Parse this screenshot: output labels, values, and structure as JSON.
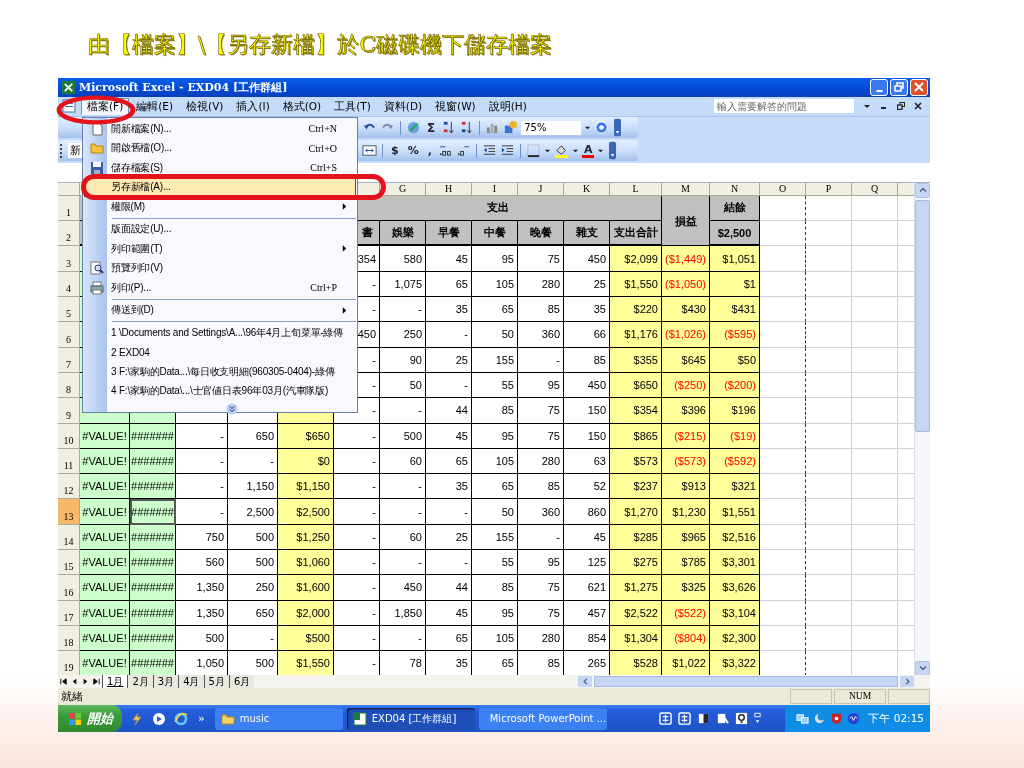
{
  "slide_title": "由【檔案】\\【另存新檔】於C磁碟機下儲存檔案",
  "window": {
    "title": "Microsoft Excel - EXD04  [工作群組]"
  },
  "menu_bar": [
    {
      "label": "檔案(F)",
      "selected": true
    },
    {
      "label": "編輯(E)",
      "selected": false
    },
    {
      "label": "檢視(V)",
      "selected": false
    },
    {
      "label": "插入(I)",
      "selected": false
    },
    {
      "label": "格式(O)",
      "selected": false
    },
    {
      "label": "工具(T)",
      "selected": false
    },
    {
      "label": "資料(D)",
      "selected": false
    },
    {
      "label": "視窗(W)",
      "selected": false
    },
    {
      "label": "說明(H)",
      "selected": false
    }
  ],
  "help_box": {
    "placeholder": "輸入需要解答的問題"
  },
  "standard_toolbar": {
    "sum": "Σ",
    "zoom": "75%"
  },
  "formatting_toolbar": {
    "font": "新",
    "buttons": [
      "$",
      "%",
      ","
    ],
    "font_color": "A"
  },
  "column_headers": [
    "G",
    "H",
    "I",
    "J",
    "K",
    "L",
    "M",
    "N",
    "O",
    "P",
    "Q"
  ],
  "rows": [
    {
      "header": "1",
      "kind": "group-heading",
      "selected": false,
      "cells": [
        null,
        null,
        null,
        null,
        null,
        "支出",
        null,
        null,
        null,
        null,
        null,
        null,
        "損益",
        "結餘"
      ]
    },
    {
      "header": "2",
      "kind": "column-heading",
      "selected": false,
      "cells": [
        null,
        null,
        null,
        null,
        null,
        "書",
        "娛樂",
        "早餐",
        "中餐",
        "晚餐",
        "雜支",
        "支出合計",
        null,
        "$2,500"
      ]
    },
    {
      "header": "3",
      "kind": "data",
      "selected": false,
      "cells": [
        null,
        null,
        null,
        null,
        null,
        "354",
        "580",
        "45",
        "95",
        "75",
        "450",
        "$2,099",
        {
          "text": "($1,449)",
          "negative": true
        },
        "$1,051"
      ]
    },
    {
      "header": "4",
      "kind": "data",
      "selected": false,
      "cells": [
        null,
        null,
        null,
        null,
        null,
        "-",
        "1,075",
        "65",
        "105",
        "280",
        "25",
        "$1,550",
        {
          "text": "($1,050)",
          "negative": true
        },
        "$1"
      ]
    },
    {
      "header": "5",
      "kind": "data",
      "selected": false,
      "cells": [
        null,
        null,
        null,
        null,
        null,
        "-",
        "-",
        "35",
        "65",
        "85",
        "35",
        "$220",
        "$430",
        "$431"
      ]
    },
    {
      "header": "6",
      "kind": "data",
      "selected": false,
      "cells": [
        null,
        null,
        null,
        null,
        null,
        "450",
        "250",
        "-",
        "50",
        "360",
        "66",
        "$1,176",
        {
          "text": "($1,026)",
          "negative": true
        },
        {
          "text": "($595)",
          "negative": true
        }
      ]
    },
    {
      "header": "7",
      "kind": "data",
      "selected": false,
      "cells": [
        null,
        null,
        null,
        null,
        null,
        "-",
        "90",
        "25",
        "155",
        "-",
        "85",
        "$355",
        "$645",
        "$50"
      ]
    },
    {
      "header": "8",
      "kind": "data",
      "selected": false,
      "cells": [
        null,
        null,
        null,
        null,
        null,
        "-",
        "50",
        "-",
        "55",
        "95",
        "450",
        "$650",
        {
          "text": "($250)",
          "negative": true
        },
        {
          "text": "($200)",
          "negative": true
        }
      ]
    },
    {
      "header": "9",
      "kind": "data",
      "selected": false,
      "cells": [
        null,
        null,
        null,
        null,
        null,
        "-",
        "-",
        "44",
        "85",
        "75",
        "150",
        "$354",
        "$396",
        "$196"
      ]
    },
    {
      "header": "10",
      "kind": "data",
      "selected": false,
      "cells": [
        "#VALUE!",
        "#######",
        "-",
        "650",
        "$650",
        "-",
        "500",
        "45",
        "95",
        "75",
        "150",
        "$865",
        {
          "text": "($215)",
          "negative": true
        },
        {
          "text": "($19)",
          "negative": true
        }
      ]
    },
    {
      "header": "11",
      "kind": "data",
      "selected": false,
      "cells": [
        "#VALUE!",
        "#######",
        "-",
        "-",
        "$0",
        "-",
        "60",
        "65",
        "105",
        "280",
        "63",
        "$573",
        {
          "text": "($573)",
          "negative": true
        },
        {
          "text": "($592)",
          "negative": true
        }
      ]
    },
    {
      "header": "12",
      "kind": "data",
      "selected": false,
      "cells": [
        "#VALUE!",
        "#######",
        "-",
        "1,150",
        "$1,150",
        "-",
        "-",
        "35",
        "65",
        "85",
        "52",
        "$237",
        "$913",
        "$321"
      ]
    },
    {
      "header": "13",
      "kind": "data",
      "selected": true,
      "cells": [
        "#VALUE!",
        {
          "text": "#######",
          "active": true
        },
        "-",
        "2,500",
        "$2,500",
        "-",
        "-",
        "-",
        "50",
        "360",
        "860",
        "$1,270",
        "$1,230",
        "$1,551"
      ]
    },
    {
      "header": "14",
      "kind": "data",
      "selected": false,
      "cells": [
        "#VALUE!",
        "#######",
        "750",
        "500",
        "$1,250",
        "-",
        "60",
        "25",
        "155",
        "-",
        "45",
        "$285",
        "$965",
        "$2,516"
      ]
    },
    {
      "header": "15",
      "kind": "data",
      "selected": false,
      "cells": [
        "#VALUE!",
        "#######",
        "560",
        "500",
        "$1,060",
        "-",
        "-",
        "-",
        "55",
        "95",
        "125",
        "$275",
        "$785",
        "$3,301"
      ]
    },
    {
      "header": "16",
      "kind": "data",
      "selected": false,
      "cells": [
        "#VALUE!",
        "#######",
        "1,350",
        "250",
        "$1,600",
        "-",
        "450",
        "44",
        "85",
        "75",
        "621",
        "$1,275",
        "$325",
        "$3,626"
      ]
    },
    {
      "header": "17",
      "kind": "data",
      "selected": false,
      "cells": [
        "#VALUE!",
        "#######",
        "1,350",
        "650",
        "$2,000",
        "-",
        "1,850",
        "45",
        "95",
        "75",
        "457",
        "$2,522",
        {
          "text": "($522)",
          "negative": true
        },
        "$3,104"
      ]
    },
    {
      "header": "18",
      "kind": "data",
      "selected": false,
      "cells": [
        "#VALUE!",
        "#######",
        "500",
        "-",
        "$500",
        "-",
        "-",
        "65",
        "105",
        "280",
        "854",
        "$1,304",
        {
          "text": "($804)",
          "negative": true
        },
        "$2,300"
      ]
    },
    {
      "header": "19",
      "kind": "data",
      "selected": false,
      "cells": [
        "#VALUE!",
        "#######",
        "1,050",
        "500",
        "$1,550",
        "-",
        "78",
        "35",
        "65",
        "85",
        "265",
        "$528",
        "$1,022",
        "$3,322"
      ]
    }
  ],
  "file_menu": [
    {
      "kind": "item",
      "label": "開新檔案(N)...",
      "shortcut": "Ctrl+N",
      "submenu": false,
      "selected": false
    },
    {
      "kind": "item",
      "label": "開啟舊檔(O)...",
      "shortcut": "Ctrl+O",
      "submenu": false,
      "selected": false
    },
    {
      "kind": "item",
      "label": "儲存檔案(S)",
      "shortcut": "Ctrl+S",
      "submenu": false,
      "selected": false
    },
    {
      "kind": "item",
      "label": "另存新檔(A)...",
      "submenu": false,
      "selected": true
    },
    {
      "kind": "item",
      "label": "權限(M)",
      "submenu": true,
      "selected": false
    },
    {
      "kind": "separator"
    },
    {
      "kind": "item",
      "label": "版面設定(U)...",
      "submenu": false,
      "selected": false
    },
    {
      "kind": "item",
      "label": "列印範圍(T)",
      "submenu": true,
      "selected": false
    },
    {
      "kind": "item",
      "label": "預覽列印(V)",
      "submenu": false,
      "selected": false
    },
    {
      "kind": "item",
      "label": "列印(P)...",
      "shortcut": "Ctrl+P",
      "submenu": false,
      "selected": false
    },
    {
      "kind": "separator"
    },
    {
      "kind": "item",
      "label": "傳送到(D)",
      "submenu": true,
      "selected": false
    },
    {
      "kind": "separator"
    },
    {
      "kind": "item",
      "label": "1 \\Documents and Settings\\A...\\96年4月上旬菜單-綠傳",
      "submenu": false,
      "selected": false
    },
    {
      "kind": "item",
      "label": "2 EXD04",
      "submenu": false,
      "selected": false
    },
    {
      "kind": "item",
      "label": "3 F:\\家駒的Data...\\每日收支明細(960305-0404)-綠傳",
      "submenu": false,
      "selected": false
    },
    {
      "kind": "item",
      "label": "4 F:\\家駒的Data\\...\\士官値日表96年03月(汽車隊版)",
      "submenu": false,
      "selected": false
    },
    {
      "kind": "more"
    }
  ],
  "sheet_tabs": [
    {
      "label": "1月",
      "selected": true
    },
    {
      "label": "2月",
      "selected": false
    },
    {
      "label": "3月",
      "selected": false
    },
    {
      "label": "4月",
      "selected": false
    },
    {
      "label": "5月",
      "selected": false
    },
    {
      "label": "6月",
      "selected": false
    }
  ],
  "status_bar": {
    "text": "就緒",
    "num": "NUM"
  },
  "taskbar": {
    "start": "開始",
    "more": "»",
    "tasks": [
      {
        "label": "music",
        "kind": "folder",
        "selected": false
      },
      {
        "label": "EXD04  [工作群組]",
        "kind": "excel",
        "selected": true
      },
      {
        "label": "Microsoft PowerPoint ...",
        "kind": "powerpoint",
        "selected": false
      }
    ],
    "clock": "下午 02:15"
  }
}
